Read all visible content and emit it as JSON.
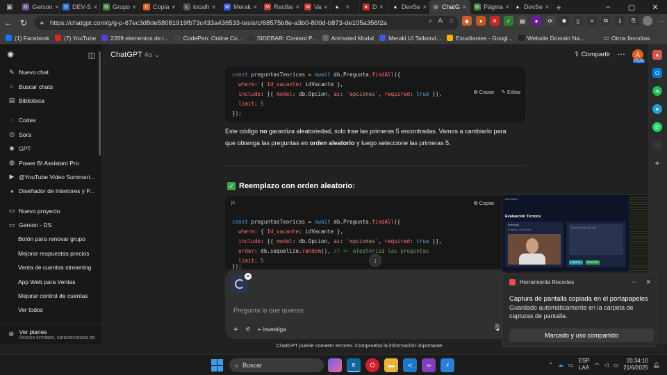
{
  "browser": {
    "tabs": [
      {
        "label": "Gerson",
        "color": "#6e5494",
        "glyph": "G"
      },
      {
        "label": "DEV-S",
        "color": "#2f6fd6",
        "glyph": "D"
      },
      {
        "label": "Grupo",
        "color": "#3c8a3c",
        "glyph": "G"
      },
      {
        "label": "Copia",
        "color": "#d4602a",
        "glyph": "C"
      },
      {
        "label": "localh",
        "color": "#555555",
        "glyph": "L"
      },
      {
        "label": "Merak",
        "color": "#3b5bdb",
        "glyph": "M"
      },
      {
        "label": "Recibe",
        "color": "#c0392b",
        "glyph": "M"
      },
      {
        "label": "Va",
        "color": "#c0392b",
        "glyph": "M"
      },
      {
        "label": "",
        "color": "#222222",
        "glyph": "▲"
      },
      {
        "label": "D",
        "color": "#cc2b2b",
        "glyph": "●"
      },
      {
        "label": "DevSe",
        "color": "#222222",
        "glyph": "▲"
      },
      {
        "label": "ChatG",
        "color": "#444444",
        "glyph": "◎",
        "active": true
      },
      {
        "label": "Página",
        "color": "#3c8a3c",
        "glyph": "G"
      },
      {
        "label": "DevSe",
        "color": "#222222",
        "glyph": "▲"
      }
    ],
    "url": "https://chatgpt.com/g/g-p-67ec3d8de58081919fb73c433a436533-tesis/c/68575b8e-a3b0-800d-b873-de105a356f2a",
    "bookmarks": [
      {
        "label": "(1) Facebook",
        "color": "#1877f2"
      },
      {
        "label": "(7) YouTube",
        "color": "#e62117"
      },
      {
        "label": "2269 elementos de i...",
        "color": "#5b3fd4"
      },
      {
        "label": "CodePen: Online Co...",
        "color": "#444444"
      },
      {
        "label": "SIDEBAR: Content P...",
        "color": "#333333"
      },
      {
        "label": "Animated Modal",
        "color": "#666666"
      },
      {
        "label": "Meraki UI Tailwind...",
        "color": "#3b5bdb"
      },
      {
        "label": "Estudiantes - Googl...",
        "color": "#f4b400"
      },
      {
        "label": "Website Domain Na...",
        "color": "#222222"
      }
    ],
    "other_favorites": "Otros favoritos"
  },
  "sidebar": {
    "primary": [
      {
        "label": "Nuevo chat",
        "icon": "edit-icon"
      },
      {
        "label": "Buscar chats",
        "icon": "search-icon"
      },
      {
        "label": "Biblioteca",
        "icon": "library-icon"
      }
    ],
    "gpts": [
      {
        "label": "Codex",
        "icon": "codex-icon"
      },
      {
        "label": "Sora",
        "icon": "sora-icon"
      },
      {
        "label": "GPT",
        "icon": "gpt-icon"
      },
      {
        "label": "Power BI Assistant Pro",
        "icon": "powerbi-icon"
      },
      {
        "label": "@YouTube Video Summari...",
        "icon": "youtube-icon"
      },
      {
        "label": "Diseñador de Interiores y P...",
        "icon": "interior-icon"
      }
    ],
    "new_project": "Nuevo proyecto",
    "project": "Gerson - DS",
    "project_chats": [
      "Botón para renovar grupo",
      "Mejorar respuestas precios",
      "Venta de cuentas streaming",
      "App Web para Ventas",
      "Mejorar control de cuentas",
      "Ver todos"
    ],
    "plans_title": "Ver planes",
    "plans_sub": "Acceso ilimitado, características de Te"
  },
  "header": {
    "model": "ChatGPT",
    "model_version": "4o",
    "share": "Compartir",
    "avatar_initial": "A",
    "avatar_badge": "PLUS"
  },
  "chat": {
    "code1_lines": [
      "const preguntasTeoricas = await db.Pregunta.findAll({",
      "  where: { Id_vacante: idVacante },",
      "  include: [{ model: db.Opcion, as: 'opciones', required: true }],",
      "  limit: 5",
      "});"
    ],
    "copy_label": "Copiar",
    "edit_label": "Editar",
    "para_pre": "Este código ",
    "para_bold1": "no",
    "para_mid": " garantiza aleatoriedad, solo trae las primeras 5 encontradas. Vamos a cambiarlo para que obtenga las preguntas en ",
    "para_bold2": "orden aleatorio",
    "para_post": " y luego seleccione las primeras 5.",
    "heading": "Reemplazo con orden aleatorio:",
    "lang_label": "js",
    "code2_lines": [
      "const preguntasTeoricas = await db.Pregunta.findAll({",
      "  where: { Id_vacante: idVacante },",
      "  include: [{ model: db.Opcion, as: 'opciones', required: true }],",
      "  order: db.sequelize.random(), // <- aleatoriza las preguntas",
      "  limit: 5",
      "});"
    ]
  },
  "composer": {
    "placeholder": "Pregunta lo que quieras",
    "investiga": "Investiga"
  },
  "disclaimer": "ChatGPT puede cometer errores. Comprueba la información importante.",
  "pip": {
    "title": "Evaluación Técnica",
    "brand": "DevSelect",
    "left_label": "Entrevista",
    "left_sub": "Pregunta 1 de 5 técnica",
    "textarea_hint": "Escribe tu respuesta aquí...",
    "btn1": "Siguiente",
    "btn2": "Grabar video"
  },
  "notification": {
    "app": "Herramienta Recortes",
    "title": "Captura de pantalla copiada en el portapapeles",
    "body": "Guardado automáticamente en la carpeta de capturas de pantalla.",
    "button": "Marcado y uso compartido"
  },
  "taskbar": {
    "search": "Buscar",
    "lang1": "ESP",
    "lang2": "LAA",
    "time": "20:34:10",
    "date": "21/6/2025"
  }
}
